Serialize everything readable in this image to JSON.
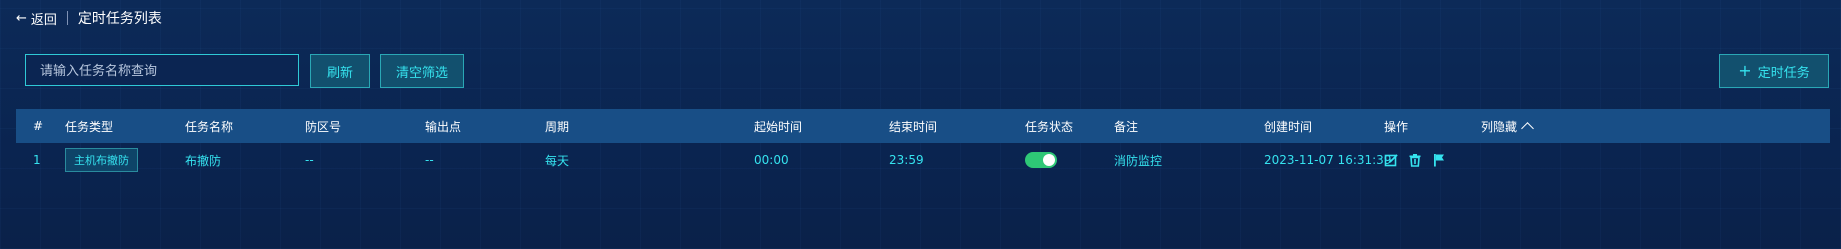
{
  "header": {
    "back_label": "返回",
    "title": "定时任务列表"
  },
  "toolbar": {
    "search_placeholder": "请输入任务名称查询",
    "search_value": "",
    "refresh_label": "刷新",
    "clear_label": "清空筛选",
    "add_label": "定时任务"
  },
  "table": {
    "columns": {
      "index": "#",
      "type": "任务类型",
      "name": "任务名称",
      "zone": "防区号",
      "output": "输出点",
      "period": "周期",
      "start": "起始时间",
      "end": "结束时间",
      "status": "任务状态",
      "remark": "备注",
      "created": "创建时间",
      "ops": "操作",
      "hide": "列隐藏"
    },
    "rows": [
      {
        "index": "1",
        "type": "主机布撤防",
        "name": "布撤防",
        "zone": "--",
        "output": "--",
        "period": "每天",
        "start": "00:00",
        "end": "23:59",
        "status_on": true,
        "remark": "消防监控",
        "created": "2023-11-07 16:31:39",
        "ops": [
          "edit-icon",
          "delete-icon",
          "flag-icon"
        ]
      }
    ]
  },
  "colors": {
    "accent": "#35e3ef",
    "header_bg": "#184e86",
    "toggle_on": "#2ec776",
    "page_bg": "#0b2552"
  }
}
